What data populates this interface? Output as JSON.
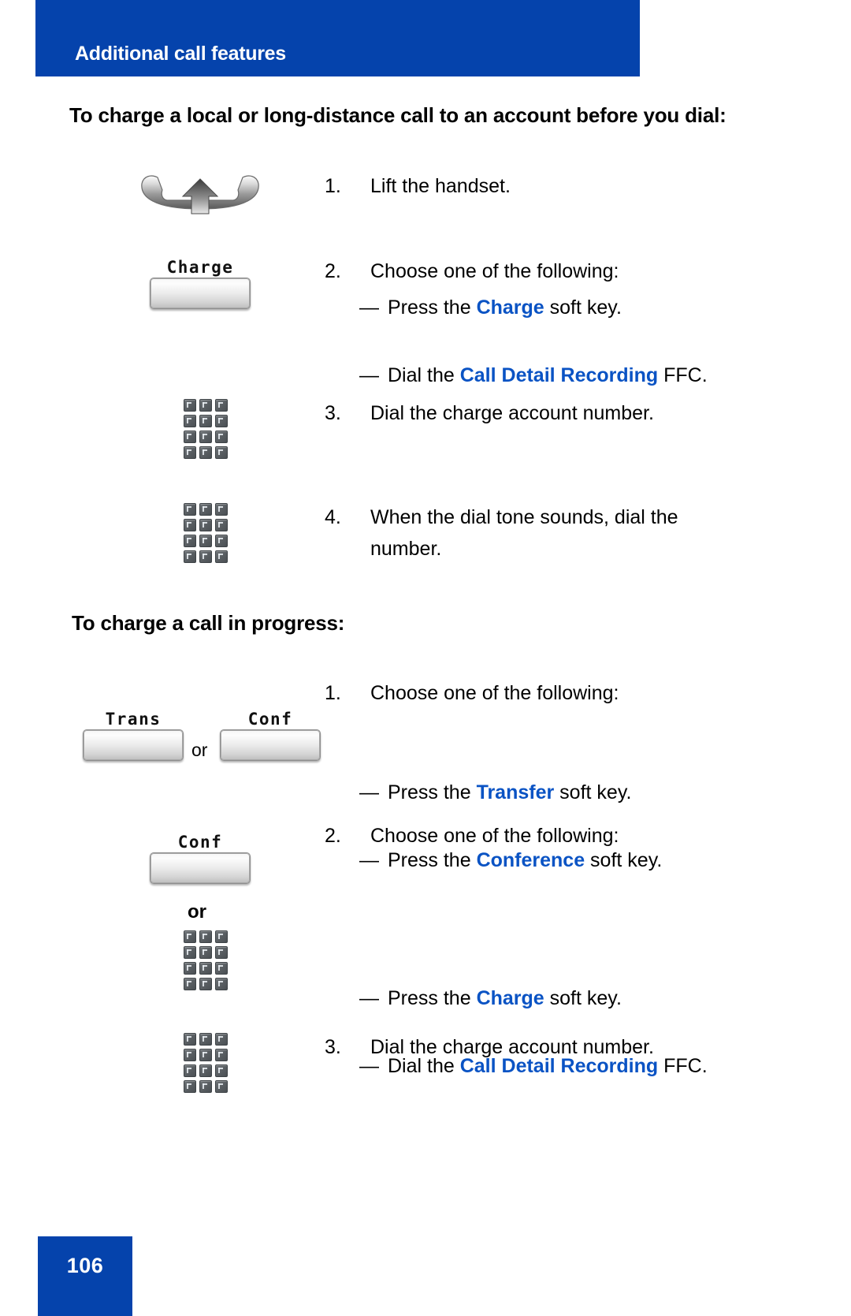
{
  "header": {
    "title": "Additional call features",
    "banner_color": "#0543ac"
  },
  "accent_color": "#0a53c4",
  "sections": [
    {
      "heading": "To charge a local or long-distance call to an account before you dial:",
      "steps": [
        {
          "number": "1.",
          "text": "Lift the handset.",
          "icon": "handset-with-up-arrow"
        },
        {
          "number": "2.",
          "text": "Choose one of the following:",
          "icon": "softkey-charge",
          "icon_label": "Charge",
          "bullets": [
            {
              "dash": "—",
              "pre": "Press the ",
              "emphasis": "Charge",
              "post": " soft key."
            },
            {
              "dash": "—",
              "pre": "Dial the ",
              "emphasis": "Call Detail Recording",
              "post": " FFC."
            }
          ]
        },
        {
          "number": "3.",
          "text": "Dial the charge account number.",
          "icon": "dialpad"
        },
        {
          "number": "4.",
          "text": "When the dial tone sounds, dial the number.",
          "icon": "dialpad"
        }
      ]
    },
    {
      "heading": "To charge a call in progress:",
      "steps": [
        {
          "number": "1.",
          "text": "Choose one of the following:",
          "icon": "softkey-trans-or-conf",
          "icon_label_left": "Trans",
          "icon_label_right": "Conf",
          "icon_separator": "or",
          "bullets": [
            {
              "dash": "—",
              "pre": "Press the ",
              "emphasis": "Transfer",
              "post": " soft key."
            },
            {
              "dash": "—",
              "pre": "Press the ",
              "emphasis": "Conference",
              "post": " soft key."
            }
          ]
        },
        {
          "number": "2.",
          "text": "Choose one of the following:",
          "icon": "softkey-conf-or-dialpad",
          "icon_label": "Conf",
          "icon_separator": "or",
          "bullets": [
            {
              "dash": "—",
              "pre": "Press the ",
              "emphasis": "Charge",
              "post": " soft key."
            },
            {
              "dash": "—",
              "pre": "Dial the ",
              "emphasis": "Call Detail Recording",
              "post": " FFC."
            }
          ]
        },
        {
          "number": "3.",
          "text": "Dial the charge account number.",
          "icon": "dialpad"
        }
      ]
    }
  ],
  "footer": {
    "page_number": "106"
  }
}
